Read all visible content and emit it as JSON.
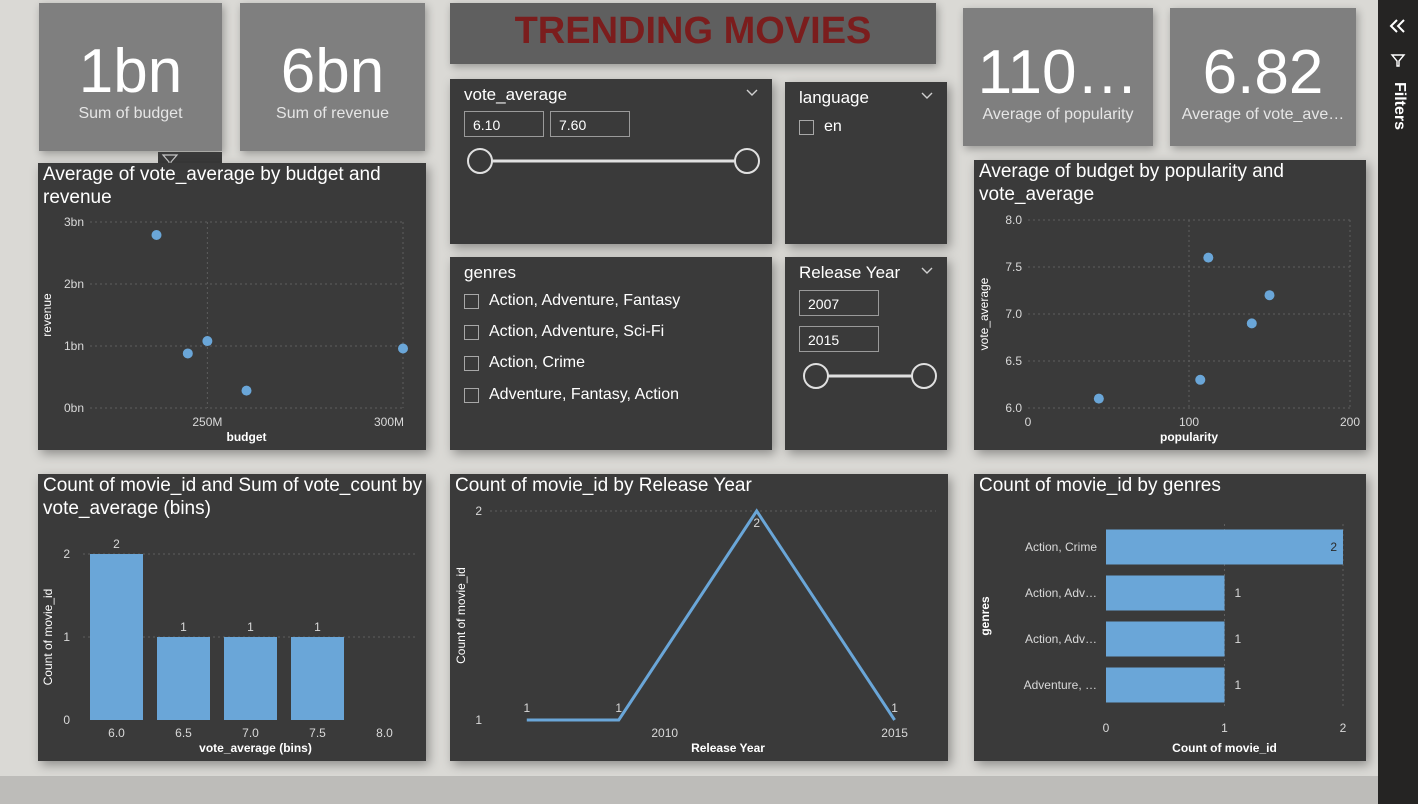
{
  "title": "TRENDING MOVIES",
  "kpis": {
    "budget": {
      "value": "1bn",
      "label": "Sum of budget"
    },
    "revenue": {
      "value": "6bn",
      "label": "Sum of revenue"
    },
    "popularity": {
      "value": "110…",
      "label": "Average of popularity"
    },
    "vote": {
      "value": "6.82",
      "label": "Average of vote_ave…"
    }
  },
  "filters_pane": {
    "label": "Filters"
  },
  "slicers": {
    "vote_average": {
      "title": "vote_average",
      "min": "6.10",
      "max": "7.60"
    },
    "language": {
      "title": "language",
      "options": [
        "en"
      ]
    },
    "genres": {
      "title": "genres",
      "options": [
        "Action, Adventure, Fantasy",
        "Action, Adventure, Sci-Fi",
        "Action, Crime",
        "Adventure, Fantasy, Action"
      ]
    },
    "release_year": {
      "title": "Release Year",
      "min": "2007",
      "max": "2015"
    }
  },
  "chart_data": [
    {
      "id": "scatter1",
      "type": "scatter",
      "title": "Average of vote_average by budget and revenue",
      "xlabel": "budget",
      "ylabel": "revenue",
      "x_ticks": [
        "250M",
        "300M"
      ],
      "y_ticks": [
        "0bn",
        "1bn",
        "2bn",
        "3bn"
      ],
      "xlim": [
        220000000,
        300000000
      ],
      "ylim": [
        0,
        3000000000
      ],
      "points": [
        {
          "x": 237000000,
          "y": 2790000000
        },
        {
          "x": 245000000,
          "y": 880000000
        },
        {
          "x": 250000000,
          "y": 1080000000
        },
        {
          "x": 260000000,
          "y": 280000000
        },
        {
          "x": 300000000,
          "y": 960000000
        }
      ]
    },
    {
      "id": "scatter2",
      "type": "scatter",
      "title": "Average of budget by popularity and vote_average",
      "xlabel": "popularity",
      "ylabel": "vote_average",
      "x_ticks": [
        "0",
        "100",
        "200"
      ],
      "y_ticks": [
        "6.0",
        "6.5",
        "7.0",
        "7.5",
        "8.0"
      ],
      "xlim": [
        0,
        200
      ],
      "ylim": [
        6.0,
        8.0
      ],
      "points": [
        {
          "x": 44,
          "y": 6.1
        },
        {
          "x": 107,
          "y": 6.3
        },
        {
          "x": 112,
          "y": 7.6
        },
        {
          "x": 139,
          "y": 6.9
        },
        {
          "x": 150,
          "y": 7.2
        }
      ]
    },
    {
      "id": "bars1",
      "type": "bar",
      "title": "Count of movie_id and Sum of vote_count by vote_average (bins)",
      "xlabel": "vote_average (bins)",
      "ylabel": "Count of movie_id",
      "categories": [
        "6.0",
        "6.5",
        "7.0",
        "7.5",
        "8.0"
      ],
      "values": [
        2,
        1,
        1,
        1,
        null
      ],
      "y_ticks": [
        "0",
        "1",
        "2"
      ],
      "ylim": [
        0,
        2
      ]
    },
    {
      "id": "line1",
      "type": "line",
      "title": "Count of movie_id by Release Year",
      "xlabel": "Release Year",
      "ylabel": "Count of movie_id",
      "x": [
        2007,
        2009,
        2012,
        2015
      ],
      "y": [
        1,
        1,
        2,
        1
      ],
      "x_ticks": [
        "2010",
        "2015"
      ],
      "y_ticks": [
        "1",
        "2"
      ],
      "xlim": [
        2006.2,
        2015.9
      ],
      "ylim": [
        1,
        2
      ]
    },
    {
      "id": "hbar1",
      "type": "bar",
      "title": "Count of movie_id by genres",
      "xlabel": "Count of movie_id",
      "ylabel": "genres",
      "categories": [
        "Action, Crime",
        "Action, Adv…",
        "Action, Adv…",
        "Adventure, …"
      ],
      "values": [
        2,
        1,
        1,
        1
      ],
      "x_ticks": [
        "0",
        "1",
        "2"
      ],
      "xlim": [
        0,
        2
      ]
    }
  ]
}
